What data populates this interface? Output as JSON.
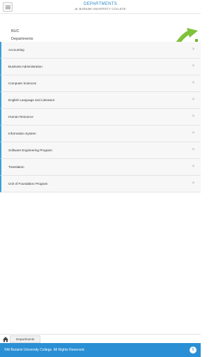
{
  "header": {
    "title": "DEPARTMENTS",
    "subtitle": "AL BURAIMI UNIVERSITY COLLEGE",
    "menu_icon": "hamburger-menu-icon"
  },
  "hero": {
    "line1": "BUC",
    "line2": "Departments"
  },
  "departments": [
    {
      "label": "Accounting"
    },
    {
      "label": "Business Administration"
    },
    {
      "label": "Computer Sciences"
    },
    {
      "label": "English Language and Literature"
    },
    {
      "label": "Human Resource"
    },
    {
      "label": "Information System"
    },
    {
      "label": "Software Engineering Program"
    },
    {
      "label": "Translation"
    },
    {
      "label": "Unit of Foundation Program"
    }
  ],
  "chevron": ">",
  "breadcrumb": {
    "home_icon": "home-icon",
    "current": "Departments"
  },
  "footer": {
    "copyright": "©Al Buraimi University College. All Rights Reserved.",
    "info_icon": "info-icon"
  },
  "colors": {
    "accent": "#2a8fd4",
    "list_bar": "#3aa0d8"
  }
}
